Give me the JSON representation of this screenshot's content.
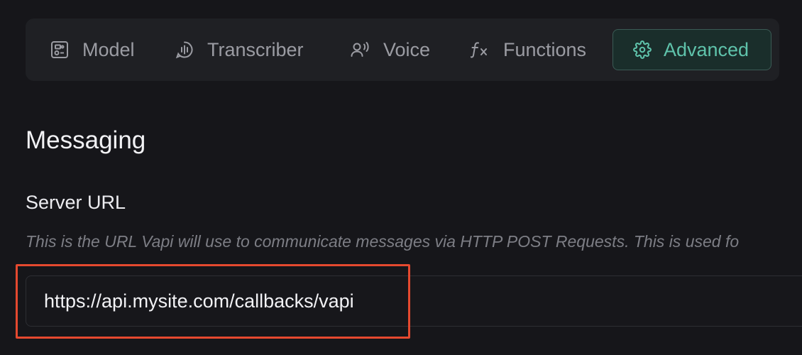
{
  "tabs": {
    "model": {
      "label": "Model",
      "icon": "model-icon"
    },
    "transcriber": {
      "label": "Transcriber",
      "icon": "transcriber-icon"
    },
    "voice": {
      "label": "Voice",
      "icon": "voice-icon"
    },
    "functions": {
      "label": "Functions",
      "icon": "function-icon"
    },
    "advanced": {
      "label": "Advanced",
      "icon": "gear-icon",
      "active": true
    }
  },
  "section": {
    "title": "Messaging"
  },
  "server_url": {
    "label": "Server URL",
    "description": "This is the URL Vapi will use to communicate messages via HTTP POST Requests. This is used fo",
    "value": "https://api.mysite.com/callbacks/vapi"
  },
  "colors": {
    "background": "#16161a",
    "tabbar_background": "#1f2024",
    "accent": "#5fc3ab",
    "highlight": "#e5492f"
  }
}
